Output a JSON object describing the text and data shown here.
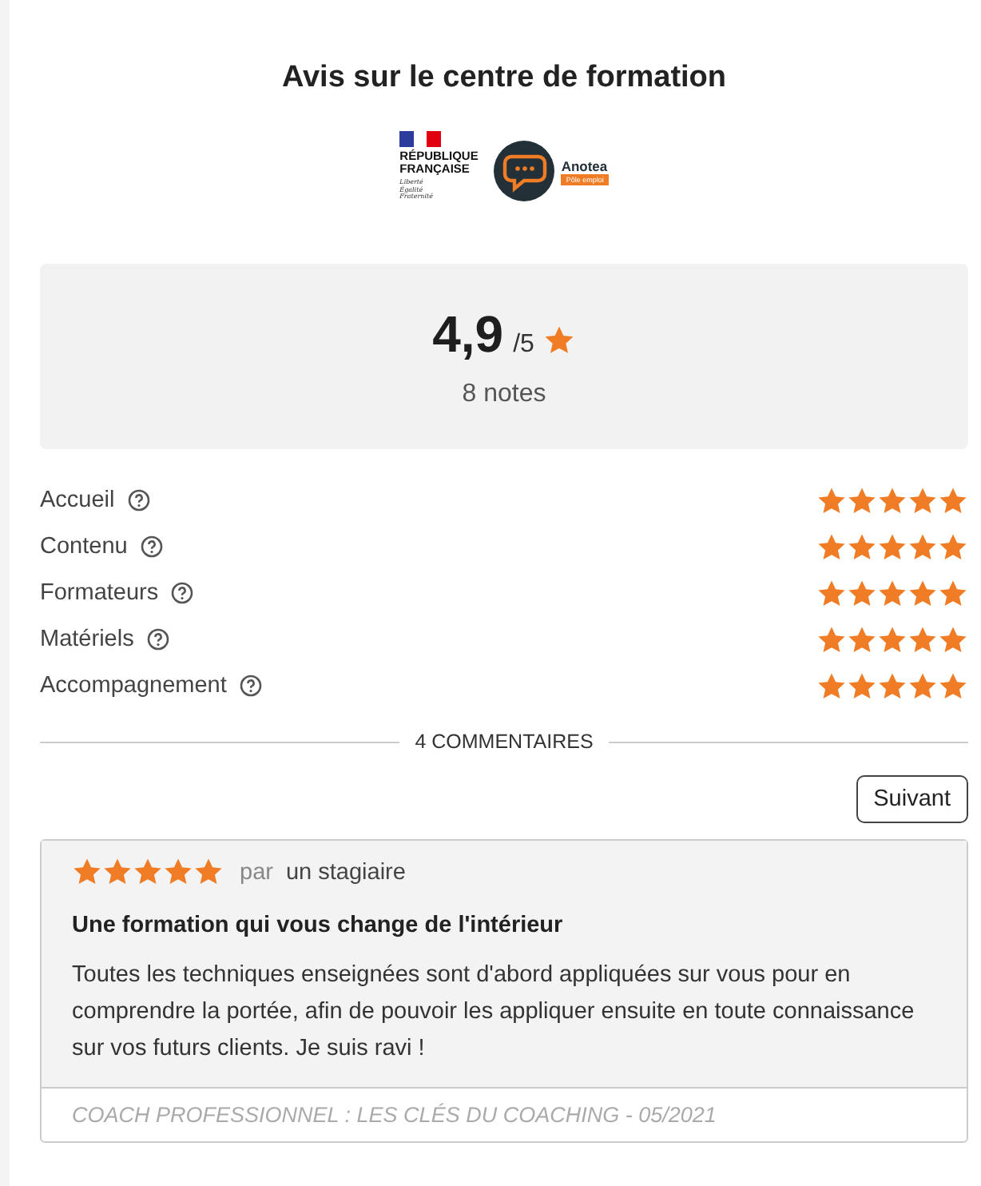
{
  "title": "Avis sur le centre de formation",
  "logos": {
    "republique": {
      "name": "RÉPUBLIQUE\nFRANÇAISE",
      "motto": "Liberté\nÉgalité\nFraternité"
    },
    "anotea": {
      "name": "Anotea",
      "badge": "Pôle emploi"
    }
  },
  "summary": {
    "score": "4,9",
    "scale": "/5",
    "count": "8 notes"
  },
  "criteria": [
    {
      "label": "Accueil",
      "stars": 5
    },
    {
      "label": "Contenu",
      "stars": 5
    },
    {
      "label": "Formateurs",
      "stars": 5
    },
    {
      "label": "Matériels",
      "stars": 5
    },
    {
      "label": "Accompagnement",
      "stars": 5
    }
  ],
  "comments_heading": "4 COMMENTAIRES",
  "next_button": "Suivant",
  "review": {
    "stars": 5,
    "by": "par",
    "author": "un stagiaire",
    "title": "Une formation qui vous change de l'intérieur",
    "text": "Toutes les techniques enseignées sont d'abord appliquées sur vous pour en comprendre la portée, afin de pouvoir les appliquer ensuite en toute connaissance sur vos futurs clients. Je suis ravi !",
    "footer": "COACH PROFESSIONNEL : LES CLÉS DU COACHING - 05/2021"
  }
}
